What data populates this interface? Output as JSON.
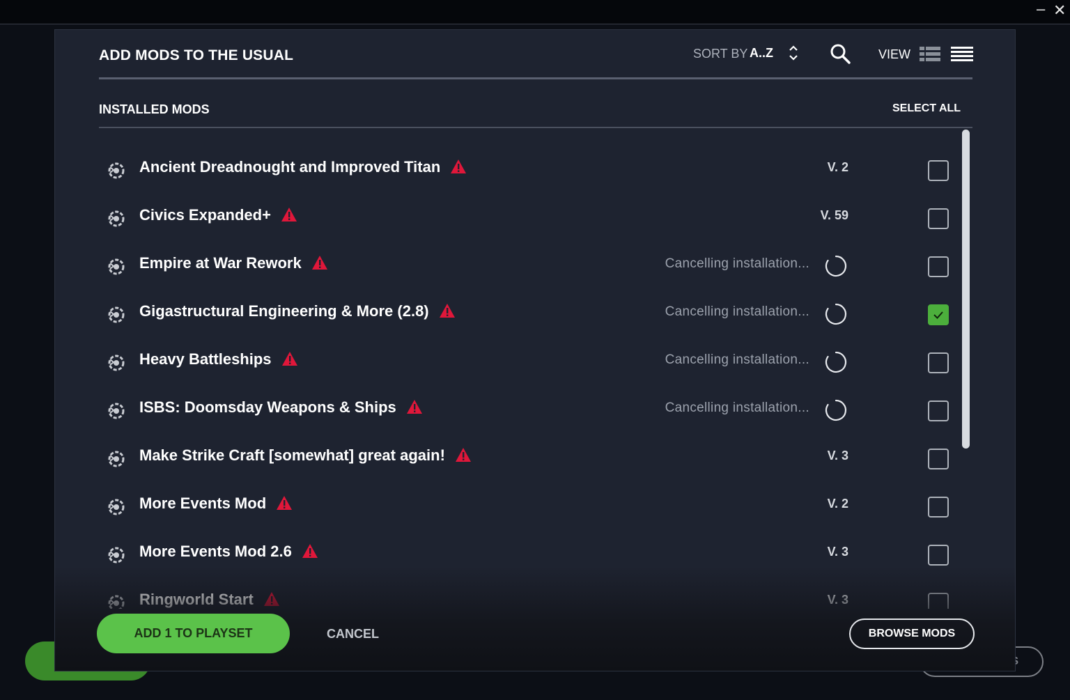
{
  "window": {
    "minimize_label": "–",
    "close_label": "✕"
  },
  "background": {
    "right_button_fragment": "DS"
  },
  "modal": {
    "title": "ADD MODS TO THE USUAL",
    "sort_label": "SORT BY",
    "sort_value": "A..Z",
    "view_label": "VIEW"
  },
  "section": {
    "label": "INSTALLED MODS",
    "select_all": "SELECT ALL"
  },
  "mods": [
    {
      "name": "Ancient Dreadnought and Improved Titan",
      "version": "V. 2",
      "status": "",
      "checked": false
    },
    {
      "name": "Civics Expanded+",
      "version": "V. 59",
      "status": "",
      "checked": false
    },
    {
      "name": "Empire at War Rework",
      "version": "",
      "status": "Cancelling installation...",
      "checked": false
    },
    {
      "name": "Gigastructural Engineering & More (2.8)",
      "version": "",
      "status": "Cancelling installation...",
      "checked": true
    },
    {
      "name": "Heavy Battleships",
      "version": "",
      "status": "Cancelling installation...",
      "checked": false
    },
    {
      "name": "ISBS: Doomsday Weapons & Ships",
      "version": "",
      "status": "Cancelling installation...",
      "checked": false
    },
    {
      "name": "Make Strike Craft [somewhat] great again!",
      "version": "V. 3",
      "status": "",
      "checked": false
    },
    {
      "name": "More Events Mod",
      "version": "V. 2",
      "status": "",
      "checked": false
    },
    {
      "name": "More Events Mod 2.6",
      "version": "V. 3",
      "status": "",
      "checked": false
    },
    {
      "name": "Ringworld Start",
      "version": "V. 3",
      "status": "",
      "checked": false
    }
  ],
  "footer": {
    "add_label": "ADD 1 TO PLAYSET",
    "cancel_label": "CANCEL",
    "browse_label": "BROWSE MODS"
  },
  "colors": {
    "accent_green": "#5bc24a",
    "warning_red": "#e0173a",
    "panel": "#1e2330"
  },
  "icons": {
    "mod": "stellaris-logo-icon",
    "warning": "warning-triangle-icon",
    "spinner": "spinner-icon",
    "search": "search-icon",
    "sort": "sort-toggle-icon",
    "view_detail": "view-detail-icon",
    "view_list": "view-list-icon"
  }
}
